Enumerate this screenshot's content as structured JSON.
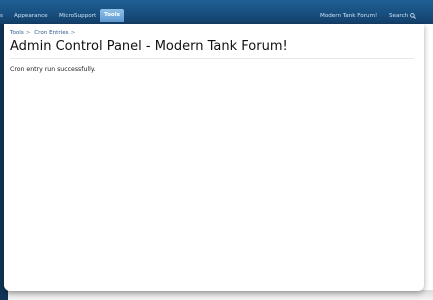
{
  "nav": {
    "tabs": [
      {
        "label": "s"
      },
      {
        "label": "Appearance"
      },
      {
        "label": "MicroSupport"
      },
      {
        "label": "Tools",
        "active": true
      }
    ],
    "forum_link": "Modern Tank Forum!",
    "search_label": "Search",
    "search_icon": "search-icon"
  },
  "breadcrumb": {
    "items": [
      "Tools",
      "Cron Entries"
    ],
    "separator": ">"
  },
  "page": {
    "title": "Admin Control Panel - Modern Tank Forum!",
    "message": "Cron entry run successfully."
  },
  "colors": {
    "nav_bar": "#184f80",
    "active_tab": "#7fb3e0",
    "link": "#2b5a8c"
  }
}
